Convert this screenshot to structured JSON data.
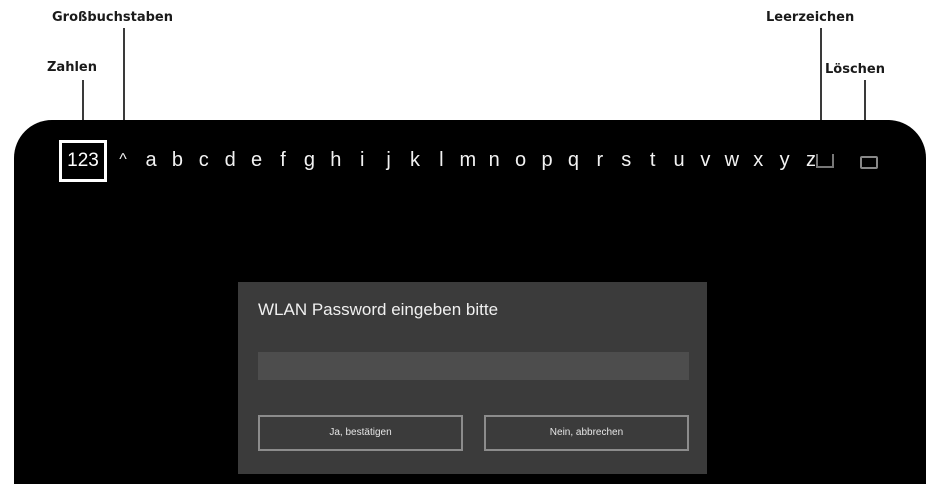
{
  "callouts": {
    "grossbuchstaben": "Großbuchstaben",
    "zahlen": "Zahlen",
    "leerzeichen": "Leerzeichen",
    "loeschen": "Löschen"
  },
  "keyboard": {
    "numbers_key": "123",
    "shift_key": "^",
    "letters": [
      "a",
      "b",
      "c",
      "d",
      "e",
      "f",
      "g",
      "h",
      "i",
      "j",
      "k",
      "l",
      "m",
      "n",
      "o",
      "p",
      "q",
      "r",
      "s",
      "t",
      "u",
      "v",
      "w",
      "x",
      "y",
      "z"
    ],
    "space_icon": "space-bar-icon",
    "delete_icon": "backspace-icon"
  },
  "dialog": {
    "title": "WLAN Password eingeben bitte",
    "password_value": "",
    "confirm_label": "Ja, bestätigen",
    "cancel_label": "Nein, abbrechen"
  },
  "colors": {
    "screen_background": "#000000",
    "dialog_background": "#3b3b3b",
    "input_background": "#4d4d4d",
    "button_border": "#8c8c8c",
    "key_text": "#f2f2f2"
  }
}
